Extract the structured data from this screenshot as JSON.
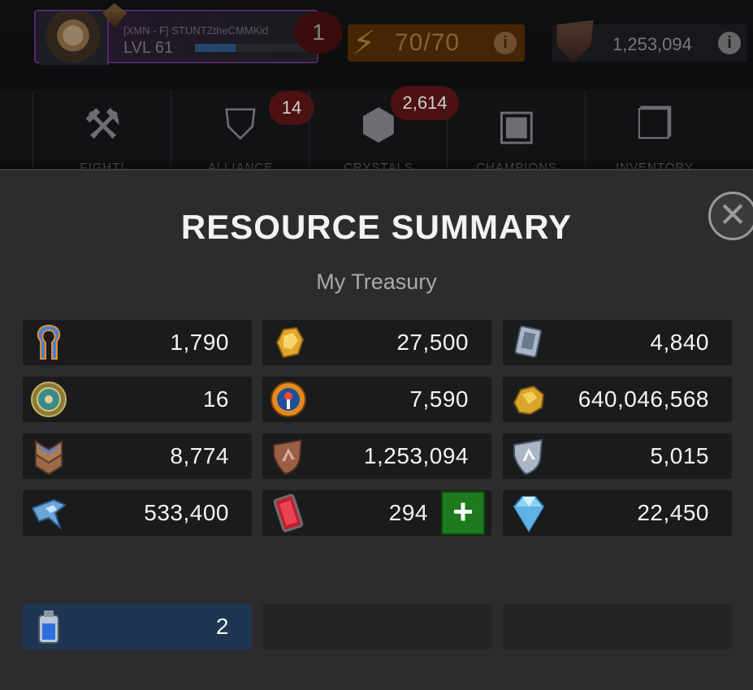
{
  "hud": {
    "player_name": "[XMN - F] STUNTZtheCMMKid",
    "level": "LVL 61",
    "xp_progress_pct": 36,
    "notification_count": "1",
    "energy": "70/70",
    "energy_info": "i",
    "gold": "1,253,094",
    "gold_info": "i"
  },
  "nav": {
    "tabs": [
      {
        "label": "FIGHT!",
        "icon": "fight-icon",
        "badge": ""
      },
      {
        "label": "ALLIANCE",
        "icon": "alliance-icon",
        "badge": "14"
      },
      {
        "label": "CRYSTALS",
        "icon": "crystal-icon",
        "badge": "2,614"
      },
      {
        "label": "CHAMPIONS",
        "icon": "champion-icon",
        "badge": ""
      },
      {
        "label": "INVENTORY",
        "icon": "inventory-icon",
        "badge": ""
      }
    ]
  },
  "modal": {
    "title": "RESOURCE SUMMARY",
    "subtitle": "My Treasury",
    "close_label": "✕",
    "resources": [
      {
        "icon": "quest-energy-icon",
        "value": "1,790"
      },
      {
        "icon": "gold-crystal-shard-icon",
        "value": "27,500"
      },
      {
        "icon": "arena-ticket-icon",
        "value": "4,840"
      },
      {
        "icon": "loyalty-coin-icon",
        "value": "16"
      },
      {
        "icon": "battlechip-icon",
        "value": "7,590"
      },
      {
        "icon": "gold-nugget-icon",
        "value": "640,046,568"
      },
      {
        "icon": "rank-shard-icon",
        "value": "8,774"
      },
      {
        "icon": "bronze-shield-icon",
        "value": "1,253,094"
      },
      {
        "icon": "silver-shield-icon",
        "value": "5,015"
      },
      {
        "icon": "cavalier-shard-icon",
        "value": "533,400"
      },
      {
        "icon": "red-card-icon",
        "value": "294"
      },
      {
        "icon": "diamond-icon",
        "value": "22,450"
      }
    ],
    "add_button_label": "+",
    "bottom_item": {
      "icon": "revive-potion-icon",
      "value": "2"
    }
  },
  "colors": {
    "modal_bg": "#2c2c2e",
    "cell_bg": "#1a1b1d",
    "highlight_cell_bg": "#1e3553",
    "add_button_green": "#1d7a1d",
    "energy_orange": "#6a3a07"
  }
}
